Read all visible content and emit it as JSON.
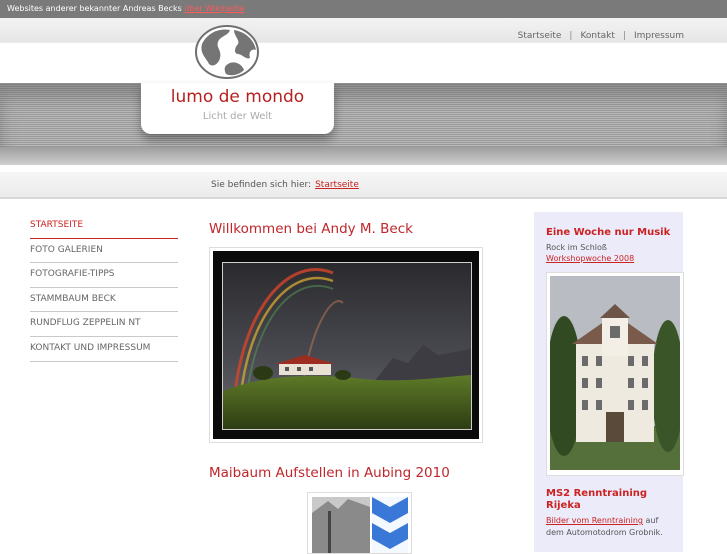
{
  "topbar": {
    "text": "Websites anderer bekannter Andreas Becks",
    "link": "über Wikipedia"
  },
  "topnav": {
    "items": [
      "Startseite",
      "Kontakt",
      "Impressum"
    ],
    "separator": "|"
  },
  "logo": {
    "title": "lumo de mondo",
    "subtitle": "Licht der Welt",
    "icon": "globe-icon"
  },
  "breadcrumb": {
    "label": "Sie befinden sich hier:",
    "link": "Startseite"
  },
  "sidenav": {
    "items": [
      "STARTSEITE",
      "FOTO GALERIEN",
      "FOTOGRAFIE-TIPPS",
      "STAMMBAUM BECK",
      "RUNDFLUG ZEPPELIN NT",
      "KONTAKT UND IMPRESSUM"
    ],
    "active_index": 0
  },
  "main": {
    "heading1": "Willkommen bei Andy M. Beck",
    "heading2": "Maibaum Aufstellen in Aubing 2010"
  },
  "sidebar": {
    "block1": {
      "title": "Eine Woche nur Musik",
      "text": "Rock im Schloß",
      "link": "Workshopwoche 2008"
    },
    "block2": {
      "title_line1": "MS2 Renntraining",
      "title_line2": "Rijeka",
      "link": "Bilder vom Renntraining",
      "text_after": "auf",
      "text_line2": "dem Automotodrom Grobnik."
    }
  },
  "colors": {
    "accent": "#cc2222",
    "topbar_bg": "#7a7a7a",
    "sidebar_bg": "#ebebfa"
  }
}
